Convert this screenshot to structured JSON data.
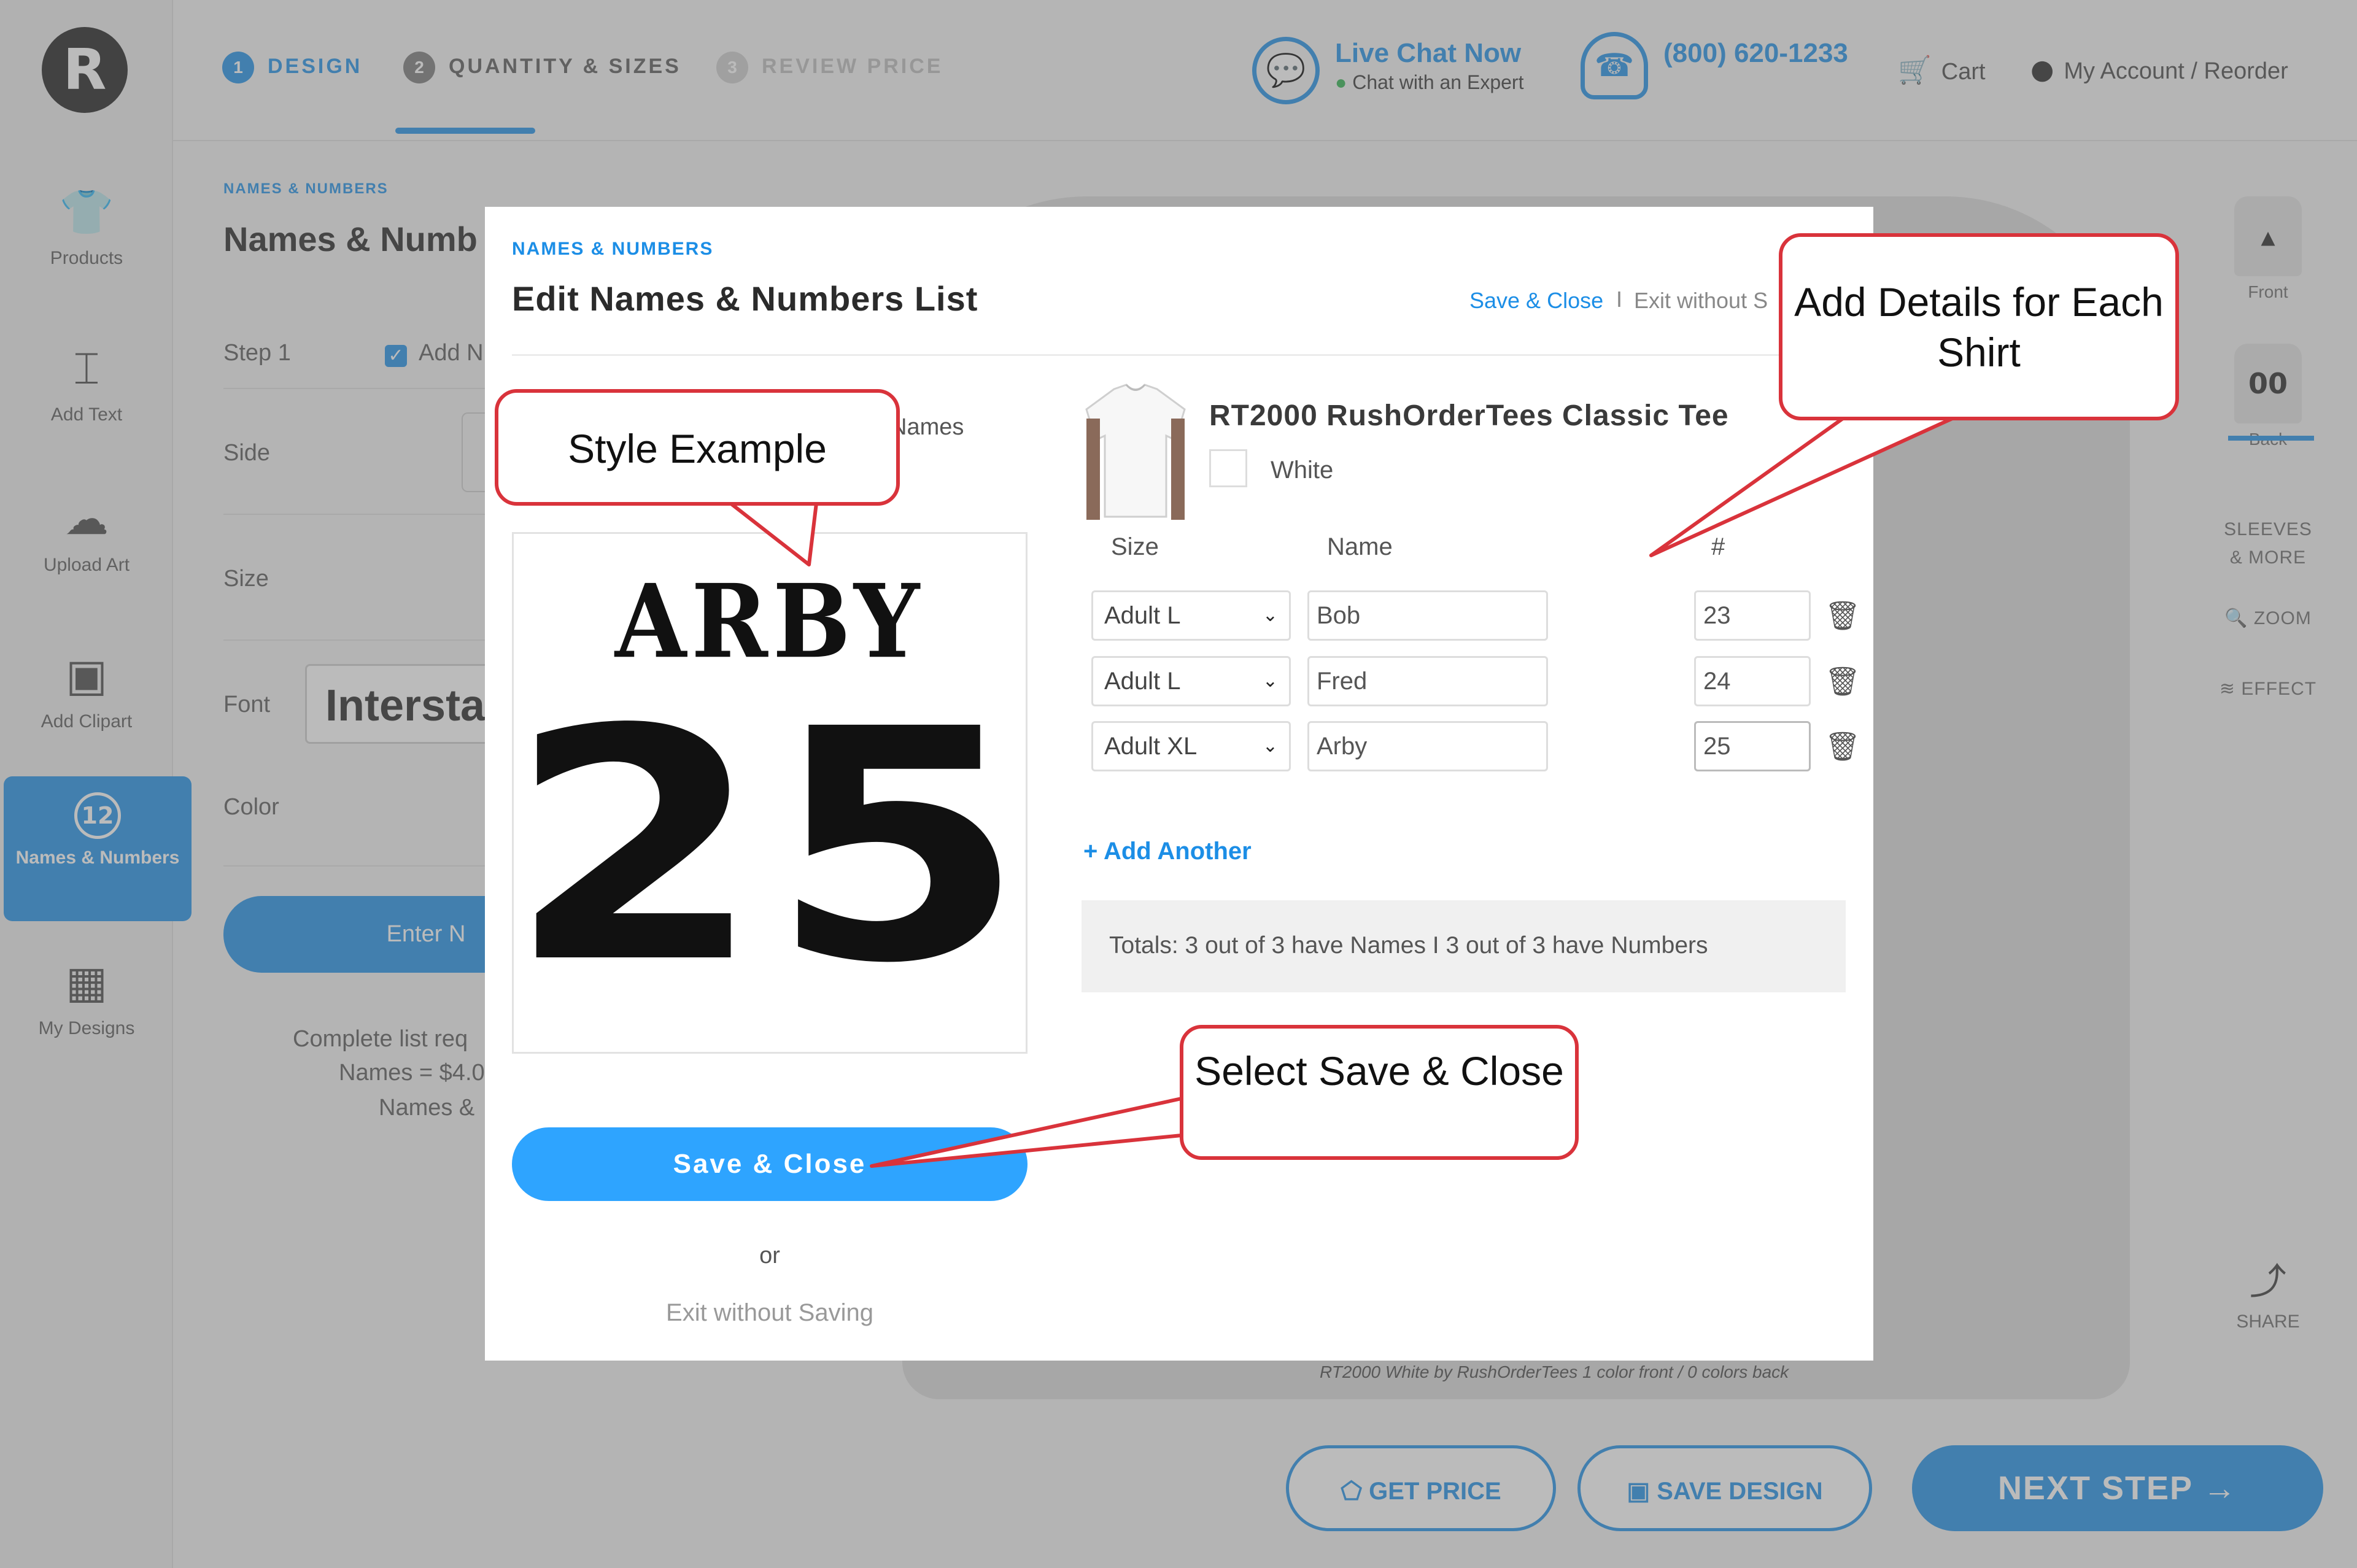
{
  "app": {
    "logo_letter": "R",
    "rail": [
      {
        "label": "Products",
        "icon": "tshirt-icon",
        "glyph": "👕"
      },
      {
        "label": "Add Text",
        "icon": "text-icon",
        "glyph": "⌶"
      },
      {
        "label": "Upload Art",
        "icon": "upload-cloud-icon",
        "glyph": "☁"
      },
      {
        "label": "Add Clipart",
        "icon": "clipart-icon",
        "glyph": "▣"
      },
      {
        "label": "Names & Numbers",
        "icon": "names-numbers-icon",
        "glyph": "12"
      },
      {
        "label": "My Designs",
        "icon": "my-designs-icon",
        "glyph": "▦"
      }
    ],
    "steps": [
      {
        "num": "1",
        "label": "DESIGN",
        "state": "active"
      },
      {
        "num": "2",
        "label": "QUANTITY & SIZES",
        "state": "normal"
      },
      {
        "num": "3",
        "label": "REVIEW PRICE",
        "state": "disabled"
      }
    ],
    "live_chat": {
      "title": "Live Chat Now",
      "subtitle": "Chat with an Expert",
      "icon": "chat-bubble-icon"
    },
    "phone": {
      "number": "(800) 620-1233",
      "icon": "headset-icon"
    },
    "cart_label": "Cart",
    "account_label": "My Account / Reorder",
    "colors": {
      "accent": "#1c8ee6",
      "button": "#2ea4ff",
      "callout_border": "#d9333b"
    }
  },
  "panel": {
    "crumb": "NAMES & NUMBERS",
    "title": "Names & Numb",
    "step1": "Step 1",
    "add_label": "Add N",
    "side": "Side",
    "size": "Size",
    "font_label": "Font",
    "font_value": "Intersta",
    "color": "Color",
    "enter_btn": "Enter N",
    "note1": "Complete list req",
    "note2": "Names = $4.0",
    "note3": "Names &"
  },
  "right_tools": {
    "front": "Front",
    "back": "Back",
    "back_number": "00",
    "sleeves": "SLEEVES & MORE",
    "zoom": "ZOOM",
    "effect": "EFFECT",
    "share": "SHARE"
  },
  "canvas": {
    "caption": "RT2000 White by RushOrderTees  1 color front  /  0 colors back"
  },
  "bottom": {
    "get_price": "GET PRICE",
    "save_design": "SAVE DESIGN",
    "next_step": "NEXT STEP"
  },
  "modal": {
    "crumb": "NAMES & NUMBERS",
    "title": "Edit Names & Numbers List",
    "save_close_link": "Save & Close",
    "separator": "I",
    "exit_link": "Exit without S",
    "names_label": "Names",
    "preview": {
      "name": "ARBY",
      "number": "25"
    },
    "save_close_btn": "Save & Close",
    "or": "or",
    "exit_btn": "Exit without Saving",
    "product": {
      "name": "RT2000 RushOrderTees Classic Tee",
      "color": "White"
    },
    "columns": {
      "size": "Size",
      "name": "Name",
      "number": "#"
    },
    "rows": [
      {
        "size": "Adult L",
        "name": "Bob",
        "number": "23"
      },
      {
        "size": "Adult L",
        "name": "Fred",
        "number": "24"
      },
      {
        "size": "Adult XL",
        "name": "Arby",
        "number": "25"
      }
    ],
    "add_another": "+ Add Another",
    "totals": "Totals: 3 out of 3 have Names I 3 out of 3 have Numbers"
  },
  "callouts": {
    "style_example": "Style Example",
    "add_details": "Add Details for Each Shirt",
    "select_save": "Select Save & Close"
  }
}
